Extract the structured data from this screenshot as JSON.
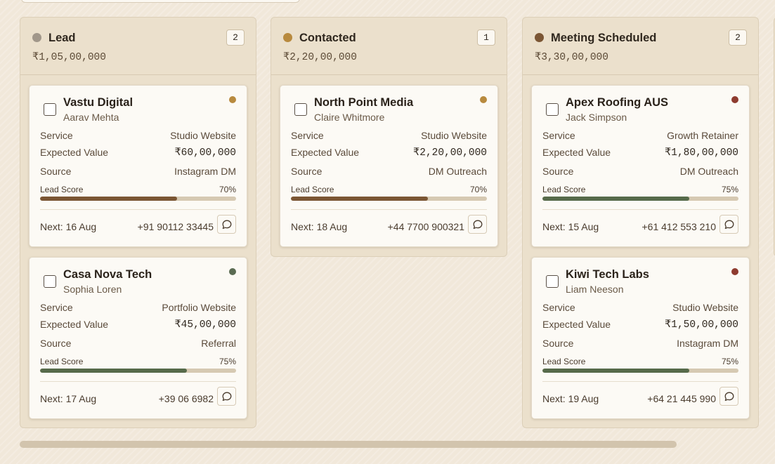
{
  "columns": [
    {
      "title": "Lead",
      "count": "2",
      "total": "₹1,05,00,000",
      "dot_color": "#a1978a",
      "cards": [
        {
          "name": "Vastu Digital",
          "contact": "Aarav Mehta",
          "priority_color": "#b88a3e",
          "service_label": "Service",
          "service": "Studio Website",
          "value_label": "Expected Value",
          "value": "₹60,00,000",
          "source_label": "Source",
          "source": "Instagram DM",
          "score_label": "Lead Score",
          "score": "70%",
          "score_value": 70,
          "score_color": "#7b5634",
          "next": "Next: 16 Aug",
          "phone": "+91 90112 33445",
          "message_icon": "chat-bubble-icon"
        },
        {
          "name": "Casa Nova Tech",
          "contact": "Sophia Loren",
          "priority_color": "#5a6b52",
          "service_label": "Service",
          "service": "Portfolio Website",
          "value_label": "Expected Value",
          "value": "₹45,00,000",
          "source_label": "Source",
          "source": "Referral",
          "score_label": "Lead Score",
          "score": "75%",
          "score_value": 75,
          "score_color": "#566a4a",
          "next": "Next: 17 Aug",
          "phone": "+39 06 6982",
          "message_icon": "chat-bubble-icon"
        }
      ]
    },
    {
      "title": "Contacted",
      "count": "1",
      "total": "₹2,20,00,000",
      "dot_color": "#b88a3e",
      "cards": [
        {
          "name": "North Point Media",
          "contact": "Claire Whitmore",
          "priority_color": "#b88a3e",
          "service_label": "Service",
          "service": "Studio Website",
          "value_label": "Expected Value",
          "value": "₹2,20,00,000",
          "source_label": "Source",
          "source": "DM Outreach",
          "score_label": "Lead Score",
          "score": "70%",
          "score_value": 70,
          "score_color": "#7b5634",
          "next": "Next: 18 Aug",
          "phone": "+44 7700 900321",
          "message_icon": "chat-bubble-icon"
        }
      ]
    },
    {
      "title": "Meeting Scheduled",
      "count": "2",
      "total": "₹3,30,00,000",
      "dot_color": "#7b5634",
      "cards": [
        {
          "name": "Apex Roofing AUS",
          "contact": "Jack Simpson",
          "priority_color": "#8e3b2f",
          "service_label": "Service",
          "service": "Growth Retainer",
          "value_label": "Expected Value",
          "value": "₹1,80,00,000",
          "source_label": "Source",
          "source": "DM Outreach",
          "score_label": "Lead Score",
          "score": "75%",
          "score_value": 75,
          "score_color": "#566a4a",
          "next": "Next: 15 Aug",
          "phone": "+61 412 553 210",
          "message_icon": "chat-bubble-icon"
        },
        {
          "name": "Kiwi Tech Labs",
          "contact": "Liam Neeson",
          "priority_color": "#8e3b2f",
          "service_label": "Service",
          "service": "Studio Website",
          "value_label": "Expected Value",
          "value": "₹1,50,00,000",
          "source_label": "Source",
          "source": "Instagram DM",
          "score_label": "Lead Score",
          "score": "75%",
          "score_value": 75,
          "score_color": "#566a4a",
          "next": "Next: 19 Aug",
          "phone": "+64 21 445 990",
          "message_icon": "chat-bubble-icon"
        }
      ]
    }
  ],
  "scrollbar": {
    "position_fraction": 0.0,
    "visible_fraction": 0.87
  }
}
